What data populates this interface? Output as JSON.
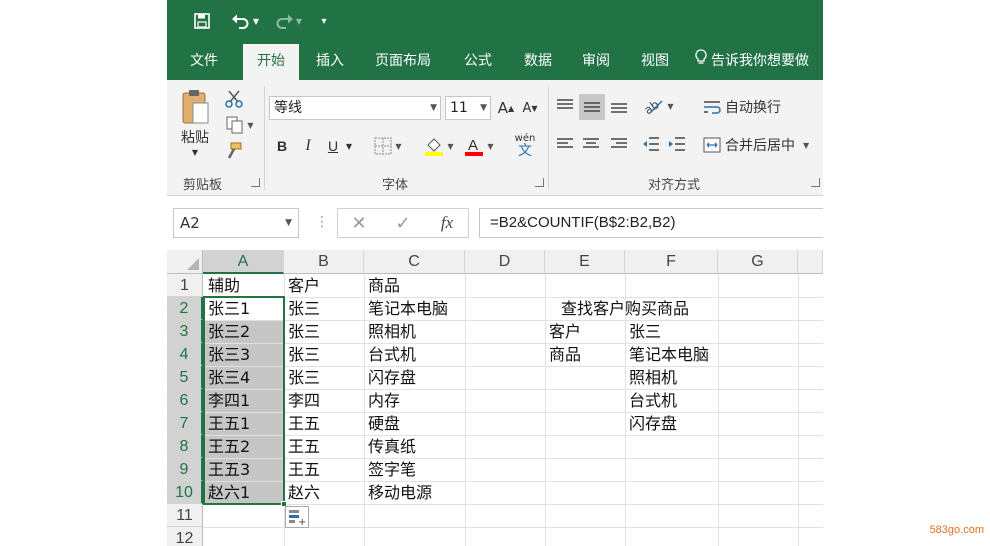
{
  "tabs": [
    {
      "label": "文件"
    },
    {
      "label": "开始"
    },
    {
      "label": "插入"
    },
    {
      "label": "页面布局"
    },
    {
      "label": "公式"
    },
    {
      "label": "数据"
    },
    {
      "label": "审阅"
    },
    {
      "label": "视图"
    }
  ],
  "tell_me": "告诉我你想要做",
  "clipboard": {
    "paste_label": "粘贴",
    "group_label": "剪贴板"
  },
  "font": {
    "name": "等线",
    "size": "11",
    "group_label": "字体",
    "bold": "B",
    "italic": "I",
    "underline": "U",
    "highlight_color": "#ffff00",
    "font_color": "#ff0000",
    "phonetic": "wén"
  },
  "alignment": {
    "wrap_text": "自动换行",
    "merge_center": "合并后居中",
    "group_label": "对齐方式"
  },
  "formula_bar": {
    "name_box": "A2",
    "formula": "=B2&COUNTIF(B$2:B2,B2)",
    "fx": "fx"
  },
  "columns": [
    "A",
    "B",
    "C",
    "D",
    "E",
    "F",
    "G"
  ],
  "rows": [
    "1",
    "2",
    "3",
    "4",
    "5",
    "6",
    "7",
    "8",
    "9",
    "10",
    "11",
    "12"
  ],
  "cells": {
    "A": [
      "辅助",
      "张三1",
      "张三2",
      "张三3",
      "张三4",
      "李四1",
      "王五1",
      "王五2",
      "王五3",
      "赵六1"
    ],
    "B": [
      "客户",
      "张三",
      "张三",
      "张三",
      "张三",
      "李四",
      "王五",
      "王五",
      "王五",
      "赵六"
    ],
    "C": [
      "商品",
      "笔记本电脑",
      "照相机",
      "台式机",
      "闪存盘",
      "内存",
      "硬盘",
      "传真纸",
      "签字笔",
      "移动电源"
    ]
  },
  "lookup": {
    "title": "查找客户购买商品",
    "customer_label": "客户",
    "customer_value": "张三",
    "product_label": "商品",
    "products": [
      "笔记本电脑",
      "照相机",
      "台式机",
      "闪存盘"
    ]
  },
  "colors": {
    "accent": "#217346"
  },
  "watermark": "583go.com"
}
